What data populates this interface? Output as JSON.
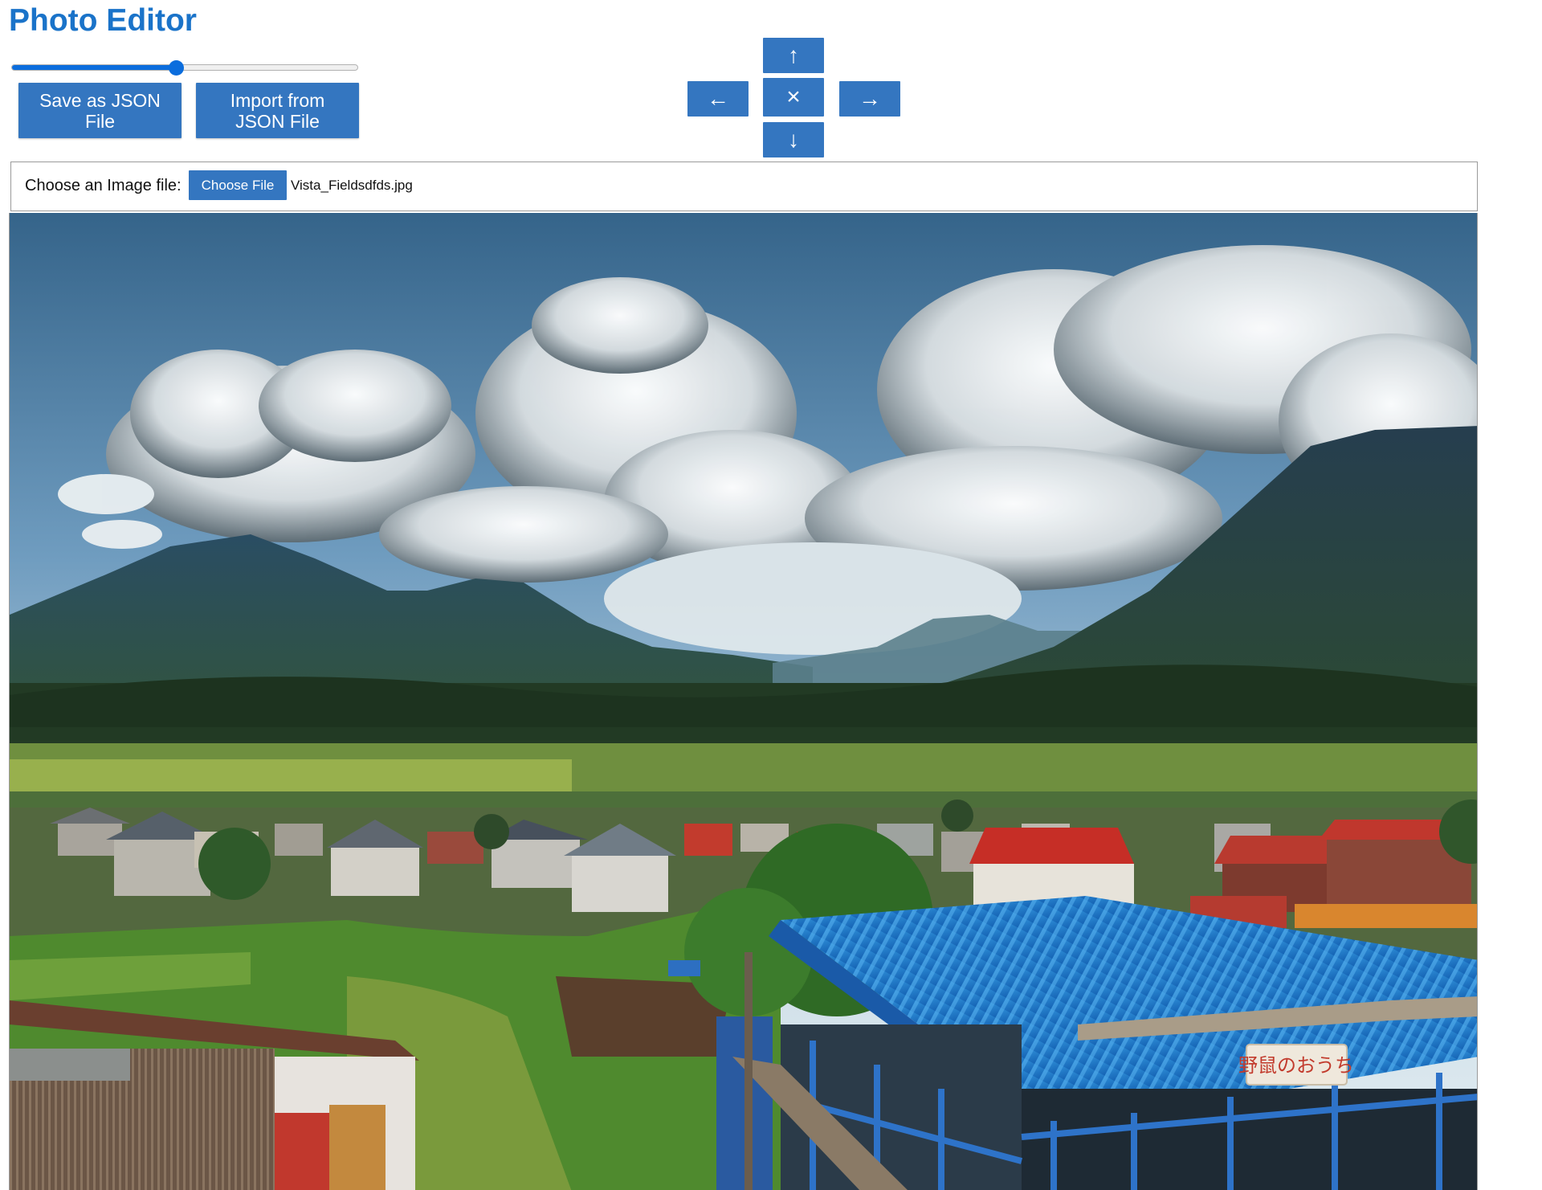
{
  "header": {
    "title": "Photo Editor"
  },
  "zoom": {
    "fraction": 0.475
  },
  "actions": {
    "save_label": "Save as JSON File",
    "import_label": "Import from JSON File"
  },
  "nav": {
    "up": "↑",
    "left": "←",
    "reset": "×",
    "right": "→",
    "down": "↓"
  },
  "file_input": {
    "label": "Choose an Image file:",
    "button_label": "Choose File",
    "file_name": "Vista_Fieldsdfds.jpg"
  },
  "photo": {
    "sign_text": "野鼠のおうち",
    "icon": "landscape-photo"
  },
  "colors": {
    "title": "#1a73c9",
    "button": "#3476c0",
    "slider": "#0b6ddd"
  }
}
